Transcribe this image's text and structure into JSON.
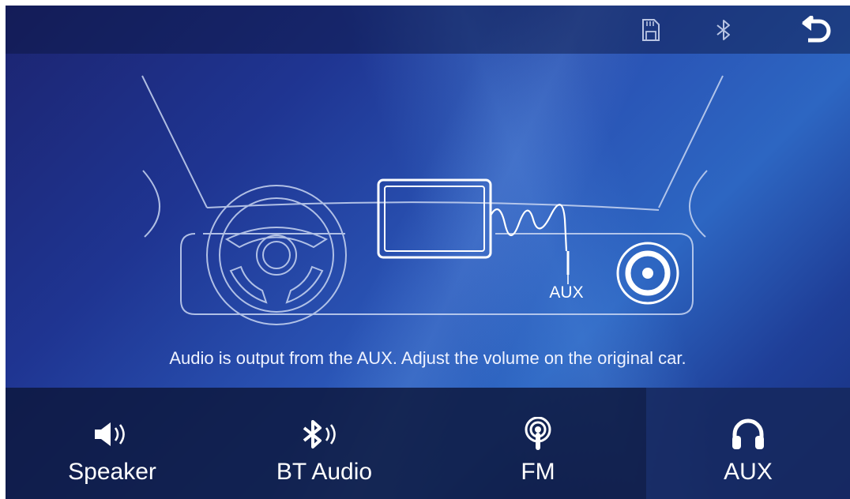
{
  "header": {
    "sd_icon": "sd-card-icon",
    "bt_icon": "bluetooth-icon",
    "back_icon": "back-arrow-icon"
  },
  "illustration": {
    "port_label": "AUX",
    "caption": "Audio is output from the AUX. Adjust the volume on the original car."
  },
  "tabs": [
    {
      "label": "Speaker",
      "icon": "speaker-icon",
      "active": false
    },
    {
      "label": "BT Audio",
      "icon": "bluetooth-audio-icon",
      "active": false
    },
    {
      "label": "FM",
      "icon": "fm-radio-icon",
      "active": false
    },
    {
      "label": "AUX",
      "icon": "headphones-icon",
      "active": true
    }
  ],
  "colors": {
    "accent": "#2d66c2",
    "bar": "#0c163a",
    "line": "#c9d6f2"
  }
}
